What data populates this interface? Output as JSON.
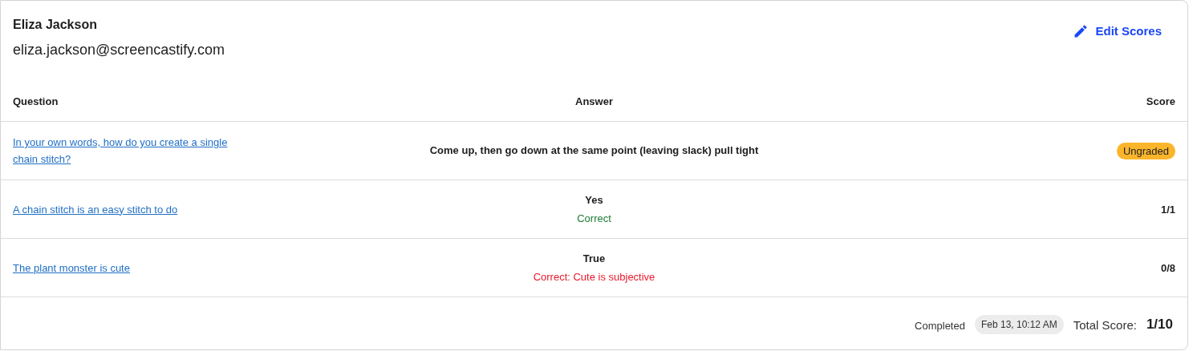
{
  "student": {
    "name": "Eliza Jackson",
    "email": "eliza.jackson@screencastify.com"
  },
  "edit_button": {
    "label": "Edit Scores"
  },
  "table": {
    "columns": [
      "Question",
      "Answer",
      "Score"
    ],
    "rows": [
      {
        "question": "In your own words, how do you create a single chain stitch?",
        "answer": "Come up, then go down at the same point (leaving slack) pull tight",
        "score": {
          "kind": "badge",
          "text": "Ungraded"
        }
      },
      {
        "question": "A chain stitch is an easy stitch to do",
        "answer": "Yes",
        "feedback": {
          "kind": "correct",
          "text": "Correct"
        },
        "score": {
          "kind": "plain",
          "text": "1/1"
        }
      },
      {
        "question": "The plant monster is cute",
        "answer": "True",
        "feedback": {
          "kind": "incorrect",
          "text": "Correct: Cute is subjective"
        },
        "score": {
          "kind": "plain",
          "text": "0/8"
        }
      }
    ]
  },
  "footer": {
    "completed_label": "Completed",
    "completed_date": "Feb 13, 10:12 AM",
    "total_label": "Total Score:",
    "total_value": "1/10"
  }
}
